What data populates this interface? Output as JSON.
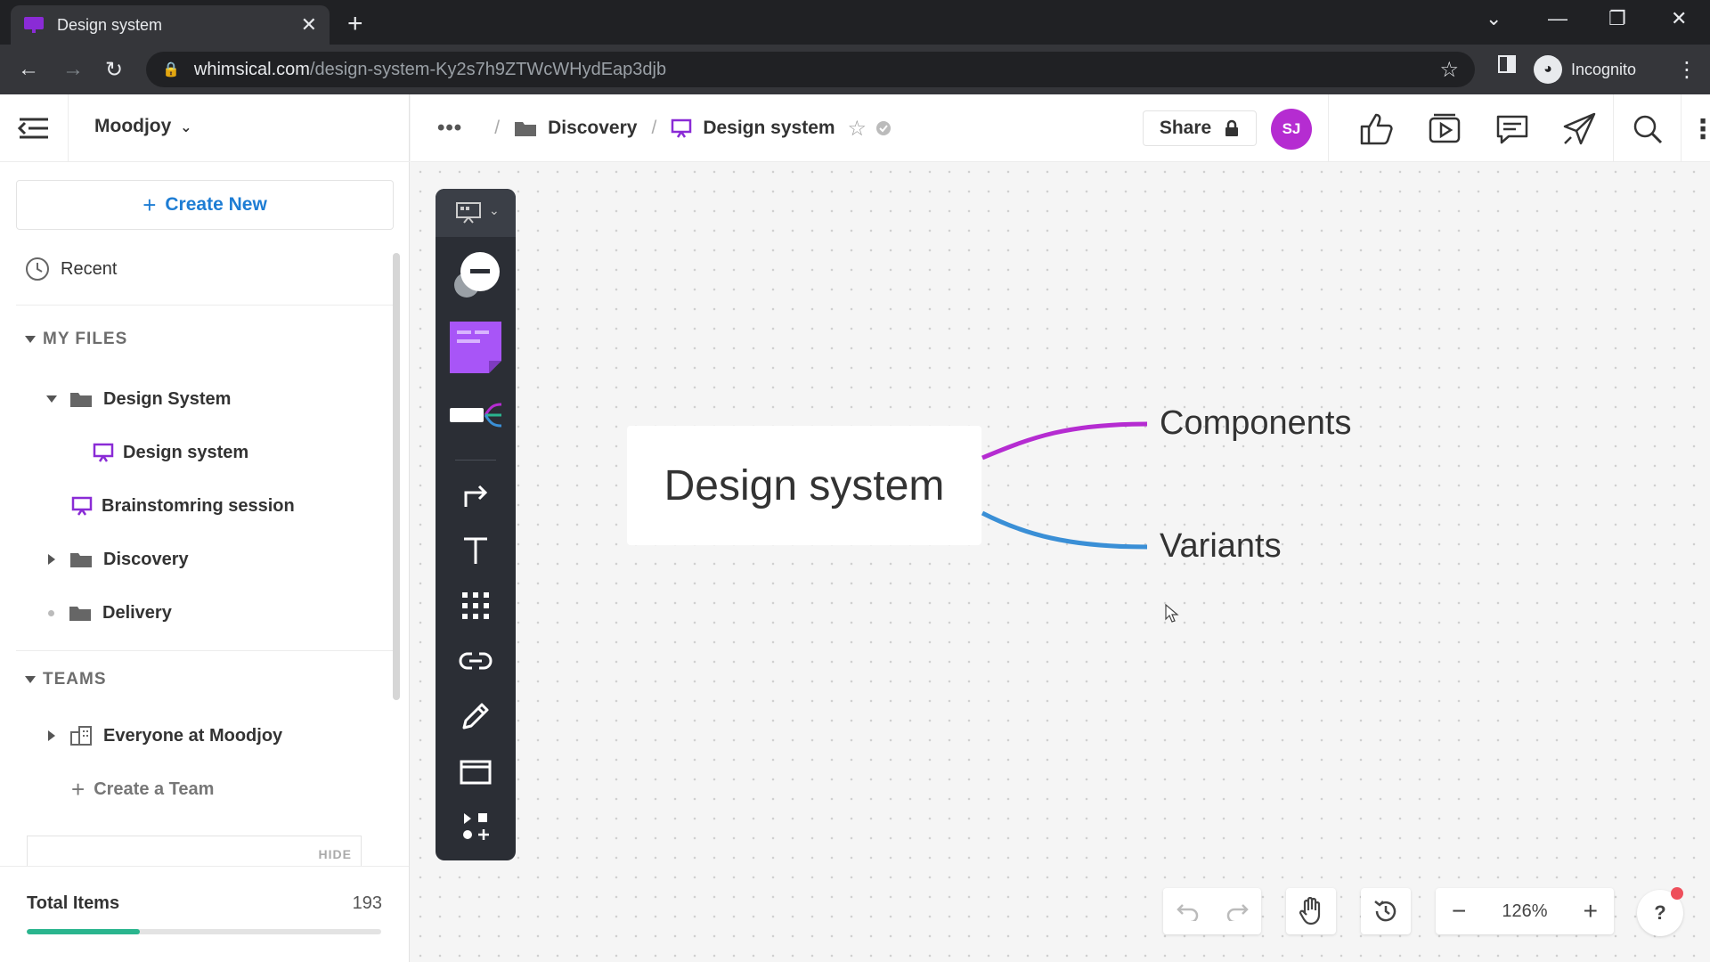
{
  "browser": {
    "tab_title": "Design system",
    "url_host": "whimsical.com",
    "url_path": "/design-system-Ky2s7h9ZTWcWHydEap3djb",
    "profile_label": "Incognito"
  },
  "sidebar": {
    "workspace": "Moodjoy",
    "create_new": "Create New",
    "recent": "Recent",
    "my_files_header": "MY FILES",
    "files": [
      {
        "label": "Design System"
      },
      {
        "label": "Design system"
      },
      {
        "label": "Brainstomring session"
      },
      {
        "label": "Discovery"
      },
      {
        "label": "Delivery"
      }
    ],
    "teams_header": "TEAMS",
    "teams": [
      {
        "label": "Everyone at Moodjoy"
      }
    ],
    "create_team": "Create a Team",
    "hide_label": "HIDE",
    "total_label": "Total Items",
    "total_count": "193",
    "total_progress": 0.32
  },
  "topbar": {
    "breadcrumb_folder": "Discovery",
    "breadcrumb_doc": "Design system",
    "share_label": "Share",
    "avatar_initials": "SJ"
  },
  "canvas": {
    "root_node": "Design system",
    "children": [
      "Components",
      "Variants"
    ]
  },
  "controls": {
    "zoom": "126%",
    "help": "?"
  },
  "colors": {
    "accent": "#1e7dd4",
    "avatar": "#b52cd1",
    "branch_1": "#b52cd1",
    "branch_2": "#3a8fd6",
    "progress": "#2ab58e",
    "doc_icon": "#8a2bd6"
  }
}
